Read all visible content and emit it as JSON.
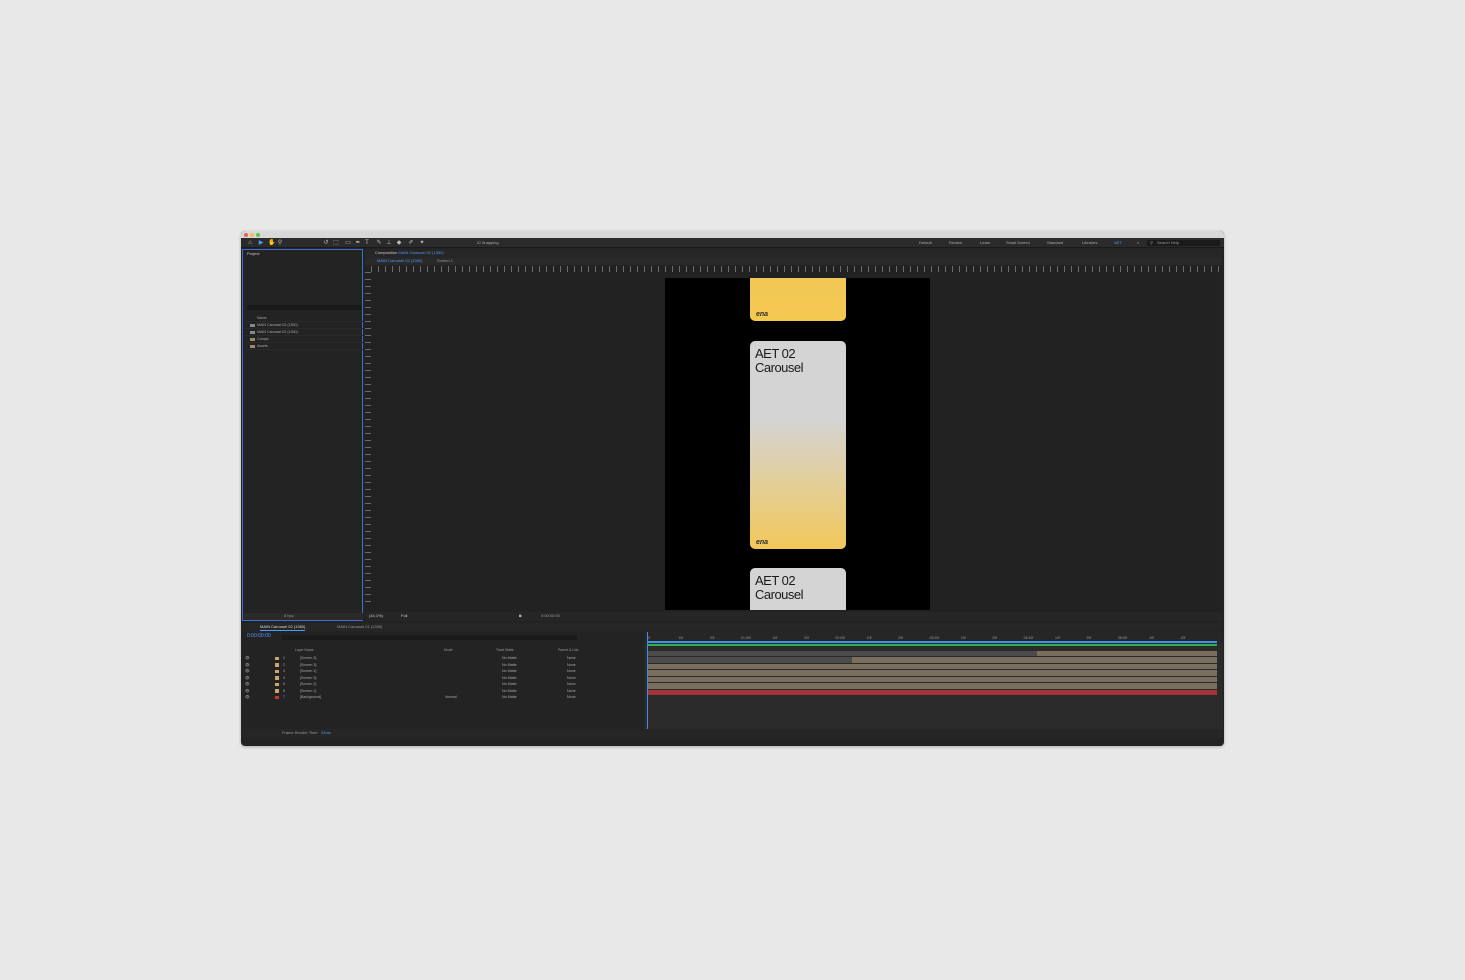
{
  "toolbar": {
    "snapping_label": "Snapping",
    "workspaces": [
      "Default",
      "Review",
      "Learn",
      "Small Screen",
      "Standard",
      "Libraries",
      "AET"
    ],
    "search_placeholder": "Search Help"
  },
  "project": {
    "tab_label": "Project",
    "items": [
      {
        "name": "Name",
        "type": "header"
      },
      {
        "name": "MAIN Carousel 02 (1350)",
        "type": "comp"
      },
      {
        "name": "MAIN Carousel 02 (1350)",
        "type": "comp"
      },
      {
        "name": "Comps",
        "type": "folder"
      },
      {
        "name": "Assets",
        "type": "folder"
      }
    ],
    "bpc_label": "8 bpc"
  },
  "composition": {
    "panel_label": "Composition",
    "comp_name": "MAIN Carousel 02 (1350)",
    "breadcrumb": [
      "MAIN Carousel 02 (1350)",
      "Screen 1"
    ],
    "zoom": "(44.1%)",
    "resolution": "Full",
    "timecode": "0:00:00:00",
    "cards": [
      {
        "title": "",
        "logo": "ena"
      },
      {
        "title": "AET 02\nCarousel",
        "logo": "ena"
      },
      {
        "title": "AET 02\nCarousel",
        "logo": ""
      }
    ]
  },
  "timeline": {
    "tabs": [
      "MAIN Carousel 02 (1350)",
      "MAIN Carousel 01 (1350)"
    ],
    "timecode": "0:00:00:00",
    "headers": {
      "layer_name": "Layer Name",
      "mode": "Mode",
      "track_matte": "Track Matte",
      "parent": "Parent & Link"
    },
    "layers": [
      {
        "num": "1",
        "name": "[Screen 3]",
        "mode": "",
        "matte": "No Matte",
        "parent": "None",
        "color": "#c9a66b"
      },
      {
        "num": "2",
        "name": "[Screen 3]",
        "mode": "",
        "matte": "No Matte",
        "parent": "None",
        "color": "#c9a66b"
      },
      {
        "num": "3",
        "name": "[Screen 1]",
        "mode": "",
        "matte": "No Matte",
        "parent": "None",
        "color": "#c9a66b"
      },
      {
        "num": "4",
        "name": "[Screen 3]",
        "mode": "",
        "matte": "No Matte",
        "parent": "None",
        "color": "#c9a66b"
      },
      {
        "num": "5",
        "name": "[Screen 2]",
        "mode": "",
        "matte": "No Matte",
        "parent": "None",
        "color": "#c9a66b"
      },
      {
        "num": "6",
        "name": "[Screen 1]",
        "mode": "",
        "matte": "No Matte",
        "parent": "None",
        "color": "#c9a66b"
      },
      {
        "num": "7",
        "name": "[Background]",
        "mode": "Normal",
        "matte": "No Matte",
        "parent": "None",
        "color": "#c0392b"
      }
    ],
    "ruler_ticks": [
      "0f",
      "10f",
      "20f",
      "01:00f",
      "10f",
      "20f",
      "02:00f",
      "10f",
      "20f",
      "03:00f",
      "10f",
      "20f",
      "04:00f",
      "10f",
      "20f",
      "05:00f",
      "10f",
      "20f"
    ],
    "frame_render_label": "Frame Render Time",
    "frame_render_value": "33ms",
    "bar_colors": {
      "normal": "#7a6e5f",
      "background": "#a3333a",
      "faded": "#4b4b4b"
    }
  }
}
